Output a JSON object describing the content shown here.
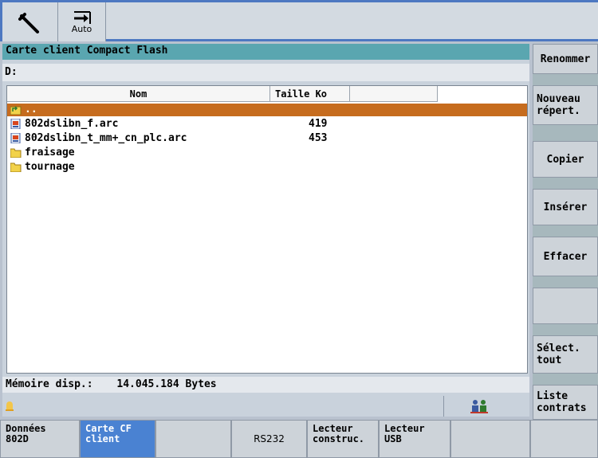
{
  "toolbar": {
    "wrench_icon": "wrench-icon",
    "auto_icon": "arrow-right-into-bar-icon",
    "auto_label": "Auto"
  },
  "panel": {
    "title": "Carte client Compact Flash",
    "path": "D:",
    "columns": {
      "name": "Nom",
      "size": "Taille Ko"
    },
    "files": [
      {
        "name": "..",
        "size": "",
        "icon": "parent-folder-icon",
        "selected": true
      },
      {
        "name": "802dslibn_f.arc",
        "size": "419",
        "icon": "archive-file-icon",
        "selected": false
      },
      {
        "name": "802dslibn_t_mm+_cn_plc.arc",
        "size": "453",
        "icon": "archive-file-icon",
        "selected": false
      },
      {
        "name": "fraisage",
        "size": "",
        "icon": "folder-icon",
        "selected": false
      },
      {
        "name": "tournage",
        "size": "",
        "icon": "folder-icon",
        "selected": false
      }
    ],
    "memory_label": "Mémoire disp.:",
    "memory_value": "14.045.184 Bytes"
  },
  "right_softkeys": [
    {
      "label": "Renommer"
    },
    {
      "label": "Nouveau répert."
    },
    {
      "label": "Copier"
    },
    {
      "label": "Insérer"
    },
    {
      "label": "Effacer"
    },
    {
      "label": ""
    },
    {
      "label": "Sélect. tout"
    },
    {
      "label": "Liste contrats"
    }
  ],
  "bottom_softkeys": [
    {
      "label": "Données 802D",
      "active": false
    },
    {
      "label": "Carte CF client",
      "active": true
    },
    {
      "label": "",
      "active": false
    },
    {
      "label": "RS232",
      "active": false
    },
    {
      "label": "Lecteur construc.",
      "active": false
    },
    {
      "label": "Lecteur USB",
      "active": false
    },
    {
      "label": "",
      "active": false
    },
    {
      "label": "",
      "active": false
    }
  ],
  "colors": {
    "accent_blue": "#4a82d2",
    "title_teal": "#5aa6b0",
    "selection_orange": "#c66c1e"
  }
}
